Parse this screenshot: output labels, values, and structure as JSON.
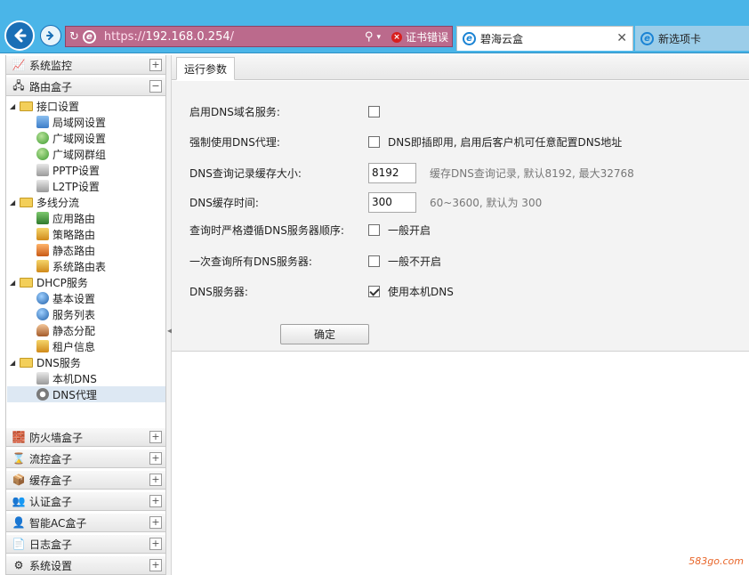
{
  "browser": {
    "url_scheme": "https://",
    "url_host": "192.168.0.254",
    "url_path": "/",
    "cert_error": "证书错误",
    "active_tab": "碧海云盒",
    "inactive_tab": "新选项卡"
  },
  "sidebar": {
    "sections": [
      {
        "label": "系统监控",
        "toggle": "+"
      },
      {
        "label": "路由盒子",
        "toggle": "−"
      },
      {
        "label": "防火墙盒子",
        "toggle": "+"
      },
      {
        "label": "流控盒子",
        "toggle": "+"
      },
      {
        "label": "缓存盒子",
        "toggle": "+"
      },
      {
        "label": "认证盒子",
        "toggle": "+"
      },
      {
        "label": "智能AC盒子",
        "toggle": "+"
      },
      {
        "label": "日志盒子",
        "toggle": "+"
      },
      {
        "label": "系统设置",
        "toggle": "+"
      }
    ],
    "tree": [
      {
        "label": "接口设置"
      },
      {
        "label": "局域网设置"
      },
      {
        "label": "广域网设置"
      },
      {
        "label": "广域网群组"
      },
      {
        "label": "PPTP设置"
      },
      {
        "label": "L2TP设置"
      },
      {
        "label": "多线分流"
      },
      {
        "label": "应用路由"
      },
      {
        "label": "策略路由"
      },
      {
        "label": "静态路由"
      },
      {
        "label": "系统路由表"
      },
      {
        "label": "DHCP服务"
      },
      {
        "label": "基本设置"
      },
      {
        "label": "服务列表"
      },
      {
        "label": "静态分配"
      },
      {
        "label": "租户信息"
      },
      {
        "label": "DNS服务"
      },
      {
        "label": "本机DNS"
      },
      {
        "label": "DNS代理"
      }
    ]
  },
  "main": {
    "tab": "运行参数",
    "fields": {
      "enable_dns": {
        "label": "启用DNS域名服务:",
        "checked": false
      },
      "force_proxy": {
        "label": "强制使用DNS代理:",
        "checked": false,
        "text": "DNS即插即用, 启用后客户机可任意配置DNS地址"
      },
      "cache_size": {
        "label": "DNS查询记录缓存大小:",
        "value": "8192",
        "hint": "缓存DNS查询记录, 默认8192, 最大32768"
      },
      "cache_time": {
        "label": "DNS缓存时间:",
        "value": "300",
        "hint": "60~3600, 默认为 300"
      },
      "strict_order": {
        "label": "查询时严格遵循DNS服务器顺序:",
        "checked": false,
        "text": "一般开启"
      },
      "query_all": {
        "label": "一次查询所有DNS服务器:",
        "checked": false,
        "text": "一般不开启"
      },
      "dns_server": {
        "label": "DNS服务器:",
        "checked": true,
        "text": "使用本机DNS"
      }
    },
    "ok_label": "确定"
  },
  "watermark": "583go.com"
}
